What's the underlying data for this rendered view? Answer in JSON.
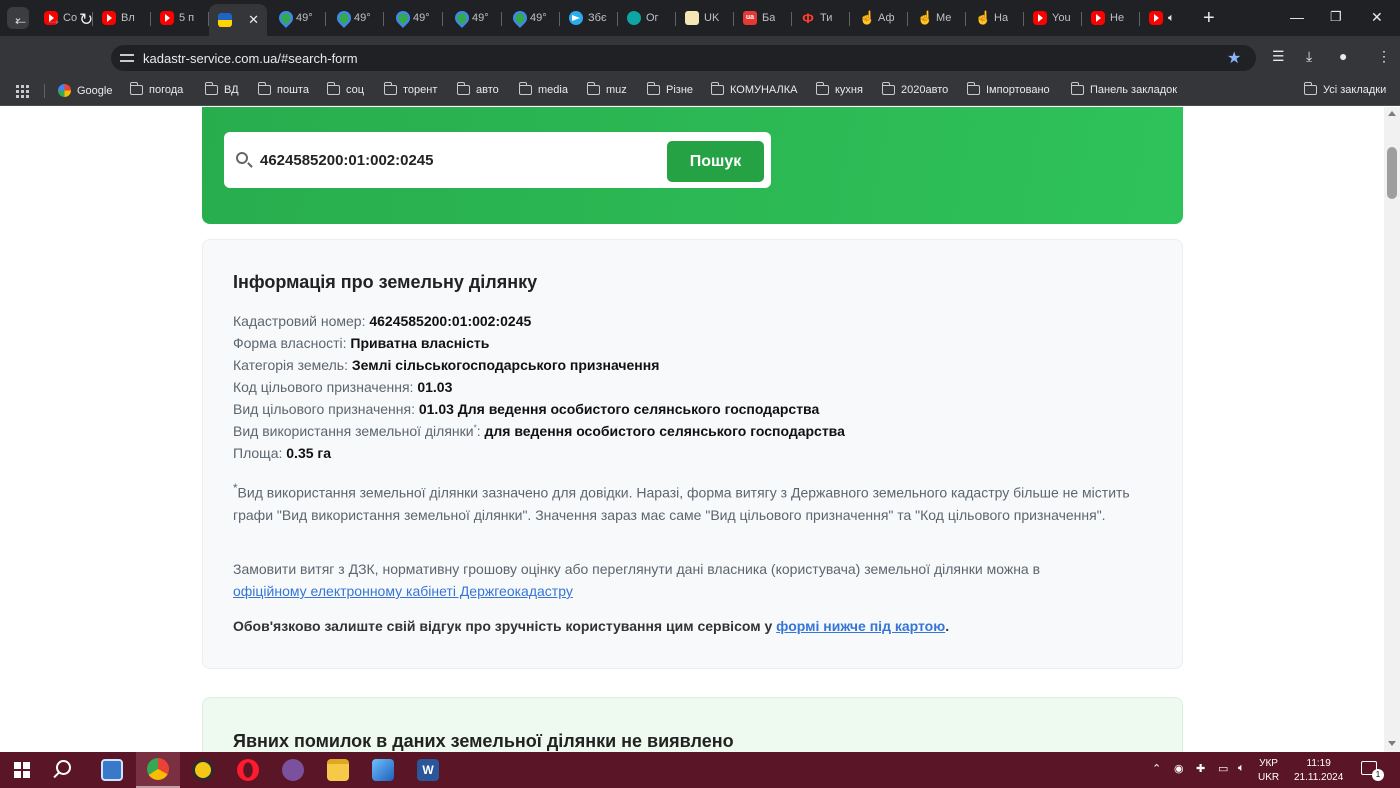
{
  "browser": {
    "tabs": [
      {
        "icon": "youtube-icon",
        "title": "Co"
      },
      {
        "icon": "youtube-icon",
        "title": "Вл"
      },
      {
        "icon": "youtube-icon",
        "title": "5 п"
      },
      {
        "icon": "ukraine-flag-icon",
        "title": "",
        "active": true
      },
      {
        "icon": "maps-pin-icon",
        "title": "49°"
      },
      {
        "icon": "maps-pin-icon",
        "title": "49°"
      },
      {
        "icon": "maps-pin-icon",
        "title": "49°"
      },
      {
        "icon": "maps-pin-icon",
        "title": "49°"
      },
      {
        "icon": "maps-pin-icon",
        "title": "49°"
      },
      {
        "icon": "telegram-icon",
        "title": "Збє"
      },
      {
        "icon": "orange-circle-icon",
        "title": "Ог"
      },
      {
        "icon": "document-icon",
        "title": "UK"
      },
      {
        "icon": "ua-red-icon",
        "title": "Ба"
      },
      {
        "icon": "phi-icon",
        "title": "Ти"
      },
      {
        "icon": "hand-icon",
        "title": "Аф"
      },
      {
        "icon": "hand-icon",
        "title": "Ме"
      },
      {
        "icon": "hand-icon",
        "title": "На"
      },
      {
        "icon": "youtube-icon",
        "title": "You"
      },
      {
        "icon": "youtube-icon",
        "title": "Не"
      },
      {
        "icon": "youtube-icon",
        "title": ""
      }
    ],
    "url": "kadastr-service.com.ua/#search-form",
    "bookmarks": [
      "Google",
      "погода",
      "ВД",
      "пошта",
      "соц",
      "торент",
      "авто",
      "media",
      "muz",
      "Різне",
      "КОМУНАЛКА",
      "кухня",
      "2020авто",
      "Імпортовано",
      "Панель закладок"
    ],
    "all_bookmarks": "Усі закладки"
  },
  "search": {
    "value": "4624585200:01:002:0245",
    "button_label": "Пошук"
  },
  "info": {
    "title": "Інформація про земельну ділянку",
    "fields": [
      {
        "label": "Кадастровий номер: ",
        "value": "4624585200:01:002:0245"
      },
      {
        "label": "Форма власності: ",
        "value": "Приватна власність"
      },
      {
        "label": "Категорія земель: ",
        "value": "Землі сільськогосподарського призначення"
      },
      {
        "label": "Код цільового призначення: ",
        "value": "01.03"
      },
      {
        "label": "Вид цільового призначення: ",
        "value": "01.03 Для ведення особистого селянського господарства"
      },
      {
        "label": "Вид використання земельної ділянки",
        "mark": "*",
        "label_tail": ": ",
        "value": "для ведення особистого селянського господарства"
      },
      {
        "label": "Площа: ",
        "value": "0.35 га"
      }
    ],
    "footnote_mark": "*",
    "footnote": "Вид використання земельної ділянки зазначено для довідки. Наразі, форма витягу з Державного земельного кадастру більше не містить графи \"Вид використання земельної ділянки\". Значення зараз має саме \"Вид цільового призначення\" та \"Код цільового призначення\".",
    "order_text": "Замовити витяг з ДЗК, нормативну грошову оцінку або переглянути дані власника (користувача) земельної ділянки можна в",
    "order_link": "офіційному електронному кабінеті Держгеокадастру",
    "feedback_text": "Обов'язково залиште свій відгук про зручність користування цим сервісом у",
    "feedback_link": "формі нижче під картою",
    "feedback_end": "."
  },
  "errors": {
    "title": "Явних помилок в даних земельної ділянки не виявлено"
  },
  "taskbar": {
    "apps": [
      "task-manager-icon",
      "chrome-icon",
      "norton-icon",
      "opera-icon",
      "viber-icon",
      "file-explorer-icon",
      "paint-icon",
      "word-icon"
    ],
    "lang_top": "УКР",
    "lang_bottom": "UKR",
    "time": "11:19",
    "date": "21.11.2024",
    "notifications": "1"
  },
  "colors": {
    "search_panel": "#2fbd58",
    "search_button": "#25a244",
    "link": "#3575d8",
    "taskbar": "#5a1626"
  }
}
